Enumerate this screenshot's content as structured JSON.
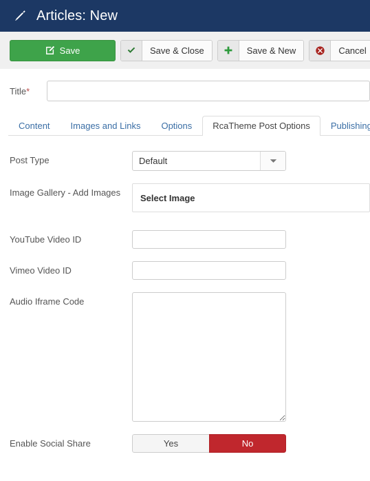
{
  "header": {
    "icon": "pencil-icon",
    "title": "Articles: New",
    "background_color": "#1c3864"
  },
  "toolbar": {
    "buttons": [
      {
        "label": "Save",
        "icon": "edit-square-icon",
        "style": "primary-green",
        "color": "#3ea34a"
      },
      {
        "label": "Save & Close",
        "icon": "check-icon",
        "style": "default",
        "color": "#2d7a33"
      },
      {
        "label": "Save & New",
        "icon": "plus-icon",
        "style": "default",
        "color": "#2d9a3c"
      },
      {
        "label": "Cancel",
        "icon": "circle-x-icon",
        "style": "default",
        "color": "#a82520"
      }
    ]
  },
  "form": {
    "title_field": {
      "label": "Title",
      "required_marker": "*",
      "value": "",
      "placeholder": ""
    }
  },
  "tabs": {
    "items": [
      {
        "label": "Content",
        "active": false
      },
      {
        "label": "Images and Links",
        "active": false
      },
      {
        "label": "Options",
        "active": false
      },
      {
        "label": "RcaTheme Post Options",
        "active": true
      },
      {
        "label": "Publishing",
        "active": false
      }
    ]
  },
  "panel": {
    "post_type": {
      "label": "Post Type",
      "value": "Default",
      "options": [
        "Default"
      ],
      "arrow_icon": "chevron-down-icon"
    },
    "image_gallery": {
      "label": "Image Gallery - Add Images",
      "button_label": "Select Image"
    },
    "youtube_video_id": {
      "label": "YouTube Video ID",
      "value": "",
      "placeholder": ""
    },
    "vimeo_video_id": {
      "label": "Vimeo Video ID",
      "value": "",
      "placeholder": ""
    },
    "audio_iframe_code": {
      "label": "Audio Iframe Code",
      "value": "",
      "placeholder": ""
    },
    "enable_social_share": {
      "label": "Enable Social Share",
      "yes_label": "Yes",
      "no_label": "No",
      "selected": "No",
      "active_color": "#c0272d"
    }
  }
}
